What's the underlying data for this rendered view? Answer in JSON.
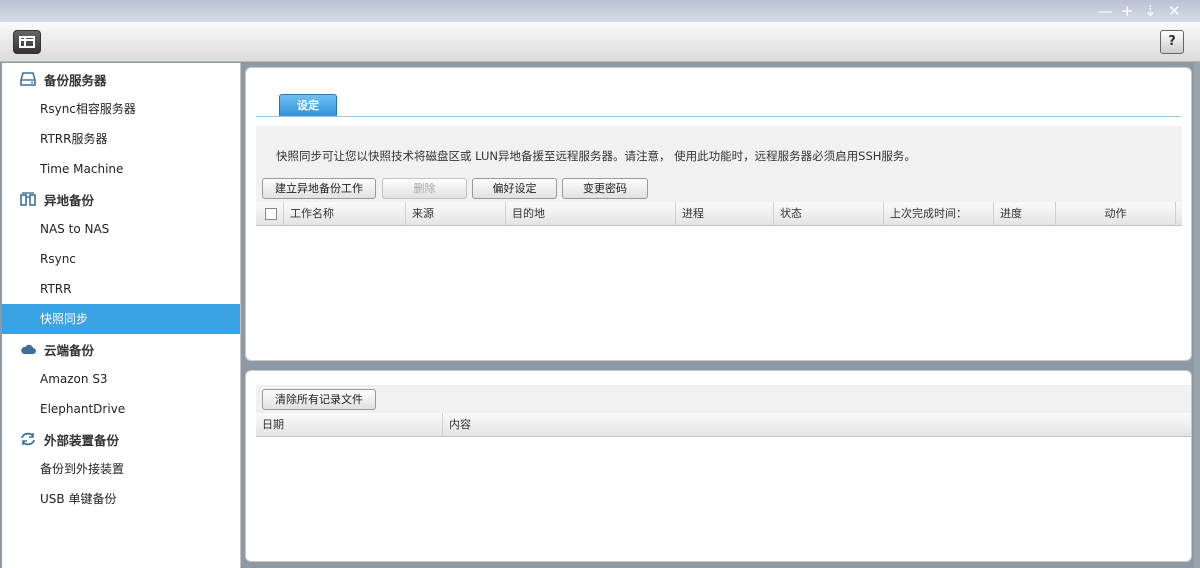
{
  "sidebar": {
    "groups": [
      {
        "label": "备份服务器",
        "icon": "server-icon"
      },
      {
        "label": "异地备份",
        "icon": "remote-icon"
      },
      {
        "label": "云端备份",
        "icon": "cloud-icon"
      },
      {
        "label": "外部装置备份",
        "icon": "sync-icon"
      }
    ],
    "items": {
      "rsync": "Rsync相容服务器",
      "rtrr_server": "RTRR服务器",
      "time_machine": "Time Machine",
      "nas_to_nas": "NAS to NAS",
      "rsync_remote": "Rsync",
      "rtrr": "RTRR",
      "snapshot_sync": "快照同步",
      "amazon_s3": "Amazon S3",
      "elephant_drive": "ElephantDrive",
      "backup_external": "备份到外接装置",
      "usb_backup": "USB 单键备份"
    },
    "active_color": "#3aa3e3"
  },
  "titlebar": {
    "help_label": "?"
  },
  "main": {
    "tab_label": "设定",
    "info_text": "快照同步可让您以快照技术将磁盘区或 LUN异地备援至远程服务器。请注意， 使用此功能时，远程服务器必须启用SSH服务。",
    "buttons": {
      "create": "建立异地备份工作",
      "delete": "删除",
      "preferences": "偏好设定",
      "change_password": "变更密码"
    },
    "columns": [
      "工作名称",
      "来源",
      "目的地",
      "进程",
      "状态",
      "上次完成时间：",
      "进度",
      "动作"
    ]
  },
  "log": {
    "clear_button": "清除所有记录文件",
    "columns": [
      "日期",
      "内容"
    ]
  }
}
